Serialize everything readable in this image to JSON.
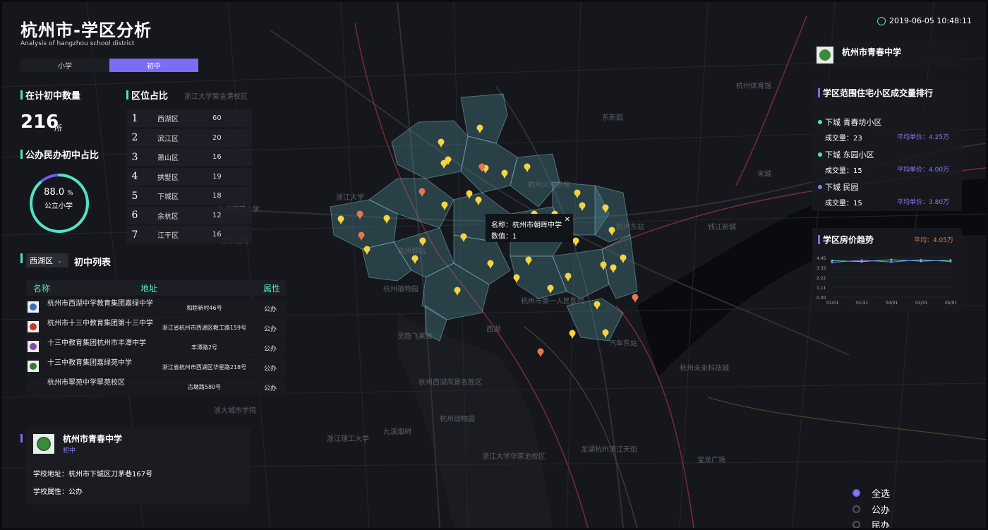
{
  "header": {
    "title": "杭州市-学区分析",
    "subtitle": "Analysis of hangzhou school district",
    "datetime": "2019-06-05 10:48:11"
  },
  "tabs": [
    {
      "label": "小学",
      "active": false
    },
    {
      "label": "初中",
      "active": true
    }
  ],
  "stats": {
    "count_title": "在计初中数量",
    "count_value": "216",
    "count_unit": "所",
    "ratio_title": "公办民办初中占比",
    "ratio_value": "88.0",
    "ratio_unit": "%",
    "ratio_label": "公立小学",
    "ratio_fraction": 0.88
  },
  "district_ratio": {
    "title": "区位占比",
    "rows": [
      {
        "rank": "1",
        "name": "西湖区",
        "value": "60"
      },
      {
        "rank": "2",
        "name": "滨江区",
        "value": "20"
      },
      {
        "rank": "3",
        "name": "萧山区",
        "value": "16"
      },
      {
        "rank": "4",
        "name": "拱墅区",
        "value": "19"
      },
      {
        "rank": "5",
        "name": "下城区",
        "value": "18"
      },
      {
        "rank": "6",
        "name": "余杭区",
        "value": "12"
      },
      {
        "rank": "7",
        "name": "江干区",
        "value": "16"
      }
    ]
  },
  "school_list": {
    "district_select": "西湖区",
    "title": "初中列表",
    "headers": {
      "name": "名称",
      "address": "地址",
      "attr": "属性"
    },
    "rows": [
      {
        "name": "杭州市西湖中学教育集团嘉绿中学",
        "address": "和睦新村46号",
        "attr": "公办"
      },
      {
        "name": "杭州市十三中教育集团第十三中学",
        "address": "浙江省杭州市西湖区教工路159号",
        "attr": "公办"
      },
      {
        "name": "十三中教育集团杭州市丰潭中学",
        "address": "丰潭路2号",
        "attr": "公办"
      },
      {
        "name": "十三中教育集团嘉绿苑中学",
        "address": "浙江省杭州市西湖区华星路218号",
        "attr": "公办"
      },
      {
        "name": "杭州市翠苑中学翠苑校区",
        "address": "古墩路580号",
        "attr": "公办"
      }
    ]
  },
  "selected_school": {
    "name": "杭州市青春中学",
    "level": "初中",
    "address_label": "学校地址：",
    "address": "杭州市下城区刀茅巷167号",
    "attr_label": "学校属性：",
    "attr": "公办"
  },
  "map_popup": {
    "name_label": "名称：",
    "name": "杭州市朝晖中学",
    "count_label": "数值：",
    "count": "1",
    "close": "✕"
  },
  "right_school": {
    "name": "杭州市青春中学"
  },
  "transactions": {
    "title": "学区范围住宅小区成交量排行",
    "items": [
      {
        "name": "下城 青春坊小区",
        "deals_label": "成交量：",
        "deals": "23",
        "price_label": "平均单价：",
        "price": "4.25万",
        "color": "#53e2c1"
      },
      {
        "name": "下城 东园小区",
        "deals_label": "成交量：",
        "deals": "15",
        "price_label": "平均单价：",
        "price": "4.00万",
        "color": "#53e2c1"
      },
      {
        "name": "下城 民园",
        "deals_label": "成交量：",
        "deals": "15",
        "price_label": "平均单价：",
        "price": "3.80万",
        "color": "#8a7cf8"
      }
    ]
  },
  "price_trend": {
    "title": "学区房价趋势",
    "avg_label": "平均：",
    "avg_value": "4.05万"
  },
  "chart_data": {
    "type": "line",
    "title": "学区房价趋势",
    "categories": [
      "01/01",
      "01/31",
      "03/01",
      "03/31",
      "05/01"
    ],
    "y_ticks": [
      "4.45",
      "3.33",
      "2.22",
      "1.11",
      "0.00"
    ],
    "ylim": [
      0,
      4.45
    ],
    "series": [
      {
        "values": [
          4.1,
          4.0,
          4.2,
          4.05,
          4.15
        ],
        "color": "#53e2c1"
      },
      {
        "values": [
          3.9,
          4.15,
          3.95,
          4.2,
          4.0
        ],
        "color": "#8a7cf8"
      }
    ]
  },
  "legend_filter": [
    {
      "label": "全选",
      "selected": true
    },
    {
      "label": "公办",
      "selected": false
    },
    {
      "label": "民办",
      "selected": false
    }
  ],
  "map_labels": [
    "浙江大学紫金港校区",
    "杭州师范大学",
    "东新园",
    "浙江大学",
    "西湖",
    "灵隐飞来峰",
    "杭州西湖风景名胜区",
    "九溪烟树",
    "杭州动物园",
    "浙江大学华家池校区",
    "杭州东站",
    "龙湖杭州滨江天街",
    "宝龙广场",
    "钱江新城",
    "杭州体育馆",
    "杭州市第一人民医院",
    "杭州城站",
    "汽车东站",
    "杭州未来科技城",
    "浙江理工大学",
    "杭州植物园",
    "西溪湿地",
    "宋城",
    "浙大城市学院",
    "杭州火车东站"
  ],
  "colors": {
    "accent": "#53e2c1",
    "purple": "#7b6cf6",
    "marker": "#f5d442",
    "marker_alt": "#e8774b"
  }
}
